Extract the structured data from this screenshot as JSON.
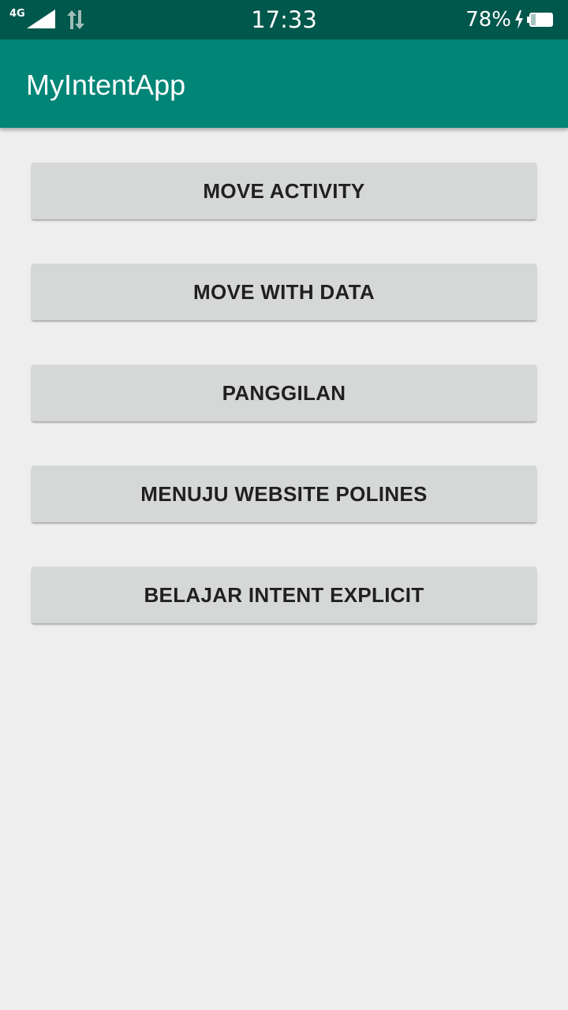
{
  "status_bar": {
    "network_type": "4G",
    "time": "17:33",
    "battery_percent": "78%",
    "icons": [
      "signal-icon",
      "data-transfer-icon",
      "charging-icon",
      "battery-icon"
    ]
  },
  "app_bar": {
    "title": "MyIntentApp"
  },
  "buttons": [
    {
      "label": "MOVE ACTIVITY"
    },
    {
      "label": "MOVE WITH DATA"
    },
    {
      "label": "PANGGILAN"
    },
    {
      "label": "MENUJU WEBSITE POLINES"
    },
    {
      "label": "BELAJAR INTENT EXPLICIT"
    }
  ],
  "colors": {
    "status_bar": "#00574b",
    "app_bar": "#008577",
    "background": "#eeeeee",
    "button": "#d6d7d7",
    "button_text": "#202020"
  }
}
